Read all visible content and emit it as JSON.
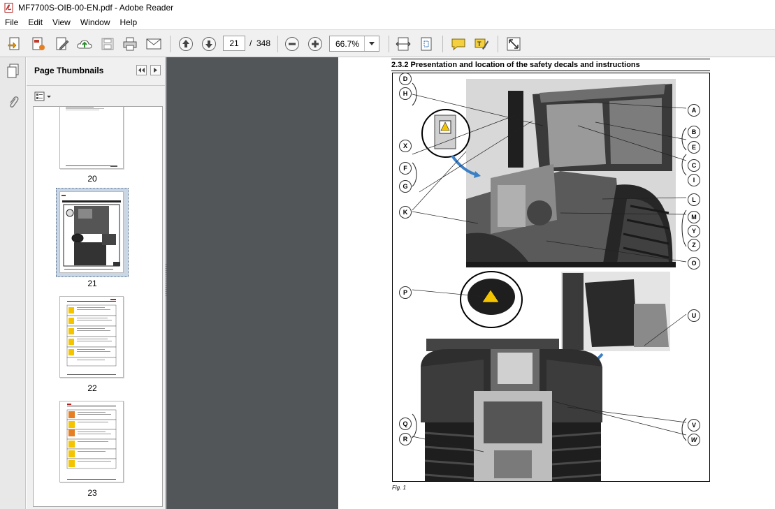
{
  "window": {
    "title": "MF7700S-OIB-00-EN.pdf - Adobe Reader"
  },
  "menu": [
    "File",
    "Edit",
    "View",
    "Window",
    "Help"
  ],
  "toolbar": {
    "icons": [
      "create-pdf-icon",
      "export-pdf-icon",
      "edit-icon",
      "cloud-upload-icon",
      "save-icon",
      "print-icon",
      "email-icon",
      "previous-page-icon",
      "next-page-icon",
      "zoom-out-icon",
      "zoom-in-icon",
      "fit-width-icon",
      "fit-page-icon",
      "comment-icon",
      "highlight-icon",
      "full-screen-icon"
    ],
    "page_current": "21",
    "page_separator": "/",
    "page_total": "348",
    "zoom": "66.7%"
  },
  "thumbnail_panel": {
    "title": "Page Thumbnails",
    "pages": [
      {
        "label": "20",
        "selected": false
      },
      {
        "label": "21",
        "selected": true
      },
      {
        "label": "22",
        "selected": false
      },
      {
        "label": "23",
        "selected": false
      }
    ]
  },
  "document": {
    "section_title": "2.3.2  Presentation and location of the safety decals and instructions",
    "figure_caption": "Fig. 1",
    "callouts_right": [
      "A",
      "B",
      "E",
      "C",
      "I",
      "L",
      "M",
      "Y",
      "Z",
      "O",
      "U",
      "V",
      "W"
    ],
    "callouts_left": [
      "D",
      "H",
      "X",
      "F",
      "G",
      "K",
      "P",
      "Q",
      "R"
    ]
  }
}
